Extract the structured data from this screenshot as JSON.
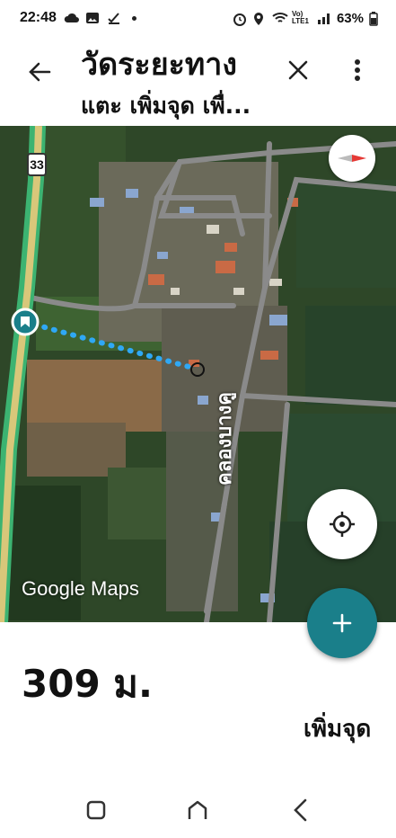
{
  "status": {
    "time": "22:48",
    "battery": "63%",
    "network": "Vo) LTE1"
  },
  "header": {
    "title": "วัดระยะทาง",
    "subtitle": "แตะ เพิ่มจุด เพื่...",
    "back_icon": "arrow-left-icon",
    "close_icon": "close-icon",
    "more_icon": "more-vert-icon"
  },
  "map": {
    "route_number": "33",
    "road_label": "คลองบางคู",
    "watermark": "Google Maps"
  },
  "measurement": {
    "distance": "309 ม.",
    "add_point_label": "เพิ่มจุด"
  },
  "colors": {
    "accent": "#1a7f8a",
    "route_line": "#2fa8f5",
    "highway": "#3cb371"
  }
}
